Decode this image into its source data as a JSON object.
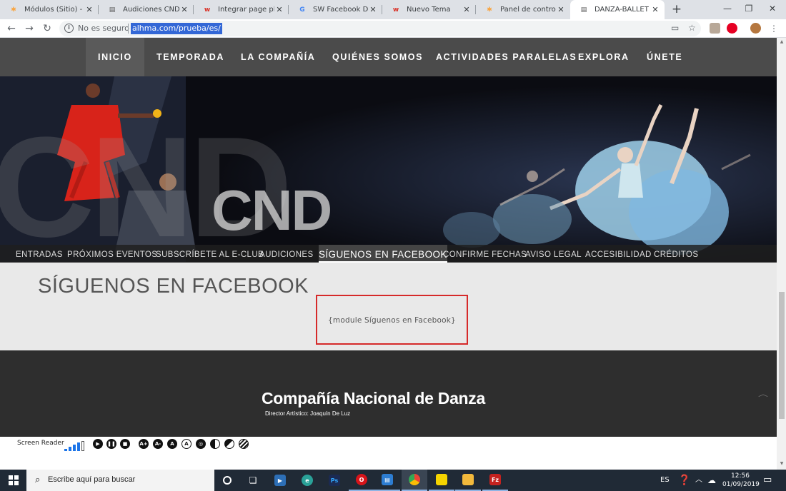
{
  "browser": {
    "tabs": [
      {
        "title": "Módulos (Sitio) - CN",
        "icon": "joomla-icon",
        "color": "#f9a541"
      },
      {
        "title": "Audiciones CND - C",
        "icon": "site-icon",
        "color": "#555555"
      },
      {
        "title": "Integrar page plugin",
        "icon": "w-icon",
        "color": "#d93025"
      },
      {
        "title": "SW Facebook Displa",
        "icon": "google-icon",
        "color": "#4285f4"
      },
      {
        "title": "Nuevo Tema",
        "icon": "w-icon",
        "color": "#d93025"
      },
      {
        "title": "Panel de control - C",
        "icon": "joomla-icon",
        "color": "#f9a541"
      },
      {
        "title": "DANZA-BALLET - CN",
        "icon": "site-icon",
        "color": "#555555",
        "active": true
      }
    ],
    "new_tab_label": "+",
    "window_controls": {
      "minimize": "—",
      "restore": "❐",
      "close": "✕"
    },
    "security_status": "No es seguro",
    "url": "alhma.com/prueba/es/"
  },
  "site": {
    "nav": [
      "INICIO",
      "TEMPORADA",
      "LA COMPAÑÍA",
      "QUIÉNES SOMOS",
      "ACTIVIDADES PARALELAS",
      "EXPLORA",
      "ÚNETE"
    ],
    "nav_active": "INICIO",
    "hero": {
      "watermark": "CND",
      "logo": "CND"
    },
    "subnav": [
      "ENTRADAS",
      "PRÓXIMOS EVENTOS",
      "SUBSCRÍBETE AL E-CLUB",
      "AUDICIONES",
      "SÍGUENOS EN FACEBOOK",
      "CONFIRME FECHAS",
      "AVISO LEGAL",
      "ACCESIBILIDAD",
      "CRÉDITOS"
    ],
    "subnav_active": "SÍGUENOS EN FACEBOOK",
    "page_title": "SÍGUENOS EN FACEBOOK",
    "module_placeholder": "{module Síguenos en Facebook}",
    "footer": {
      "name": "Compañía Nacional de Danza",
      "director": "Director Artístico: Joaquín De Luz"
    },
    "screen_reader": {
      "label": "Screen Reader",
      "controls": [
        "play-icon",
        "pause-icon",
        "stop-icon",
        "font-increase-icon",
        "font-decrease-icon",
        "font-reset-icon",
        "font-bold-icon",
        "zoom-icon",
        "contrast-icon",
        "invert-icon",
        "grayscale-icon"
      ]
    }
  },
  "taskbar": {
    "search_placeholder": "Escribe aquí para buscar",
    "language": "ES",
    "time": "12:56",
    "date": "01/09/2019",
    "apps": [
      {
        "name": "cortana-icon",
        "color": "#ffffff"
      },
      {
        "name": "task-view-icon",
        "color": "#ffffff"
      },
      {
        "name": "media-player-icon",
        "color": "#2d6fb7"
      },
      {
        "name": "browser-app-icon",
        "color": "#2aa198"
      },
      {
        "name": "photoshop-icon",
        "color": "#1b2a52"
      },
      {
        "name": "opera-icon",
        "color": "#d7141a"
      },
      {
        "name": "edge-icon",
        "color": "#2d7dd2"
      },
      {
        "name": "chrome-icon",
        "color": "#e7a21b"
      },
      {
        "name": "sticky-notes-icon",
        "color": "#f5d400"
      },
      {
        "name": "file-explorer-icon",
        "color": "#f2b93c"
      },
      {
        "name": "filezilla-icon",
        "color": "#c5221f"
      }
    ]
  }
}
